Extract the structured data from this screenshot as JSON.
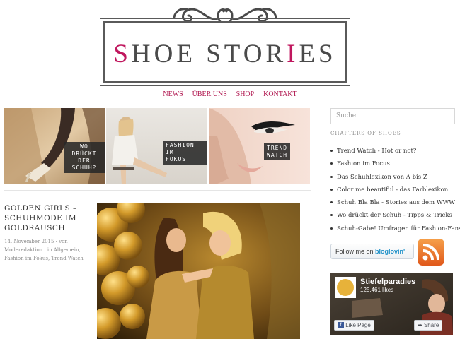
{
  "logo": {
    "prefix_pink": "S",
    "part1": "HOE STOR",
    "pink_i": "I",
    "part2": "ES"
  },
  "nav": [
    "NEWS",
    "ÜBER UNS",
    "SHOP",
    "KONTAKT"
  ],
  "tiles": [
    {
      "line1": "WO DRÜCKT",
      "line2": "DER SCHUH?"
    },
    {
      "line1": "FASHION IM",
      "line2": "FOKUS"
    },
    {
      "line1": "TREND",
      "line2": "WATCH"
    }
  ],
  "post": {
    "title_line1": "GOLDEN GIRLS –",
    "title_line2": "SCHUHMODE IM",
    "title_line3": "GOLDRAUSCH",
    "meta_line1": "14. November 2015 · von",
    "meta_line2": "Moderedaktion · in Allgemein,",
    "meta_line3": "Fashion im Fokus, Trend Watch"
  },
  "sidebar": {
    "search_placeholder": "Suche",
    "widget_title": "CHAPTERS OF SHOES",
    "chapters": [
      "Trend Watch - Hot or not?",
      "Fashion im Focus",
      "Das Schuhlexikon von A bis Z",
      "Color me beautiful - das Farblexikon",
      "Schuh Bla Bla - Stories aus dem WWW",
      "Wo drückt der Schuh - Tipps & Tricks",
      "Schuh-Gabe! Umfragen für Fashion-Fans"
    ],
    "bloglovin_prefix": "Follow me on",
    "bloglovin_brand": "bloglovin'",
    "facebook": {
      "page_name": "Stiefelparadies",
      "likes": "125,461 likes",
      "like_button": "Like Page",
      "share_button": "Share"
    }
  },
  "colors": {
    "accent": "#c0175e",
    "nav": "#b0164f",
    "text": "#333333"
  }
}
